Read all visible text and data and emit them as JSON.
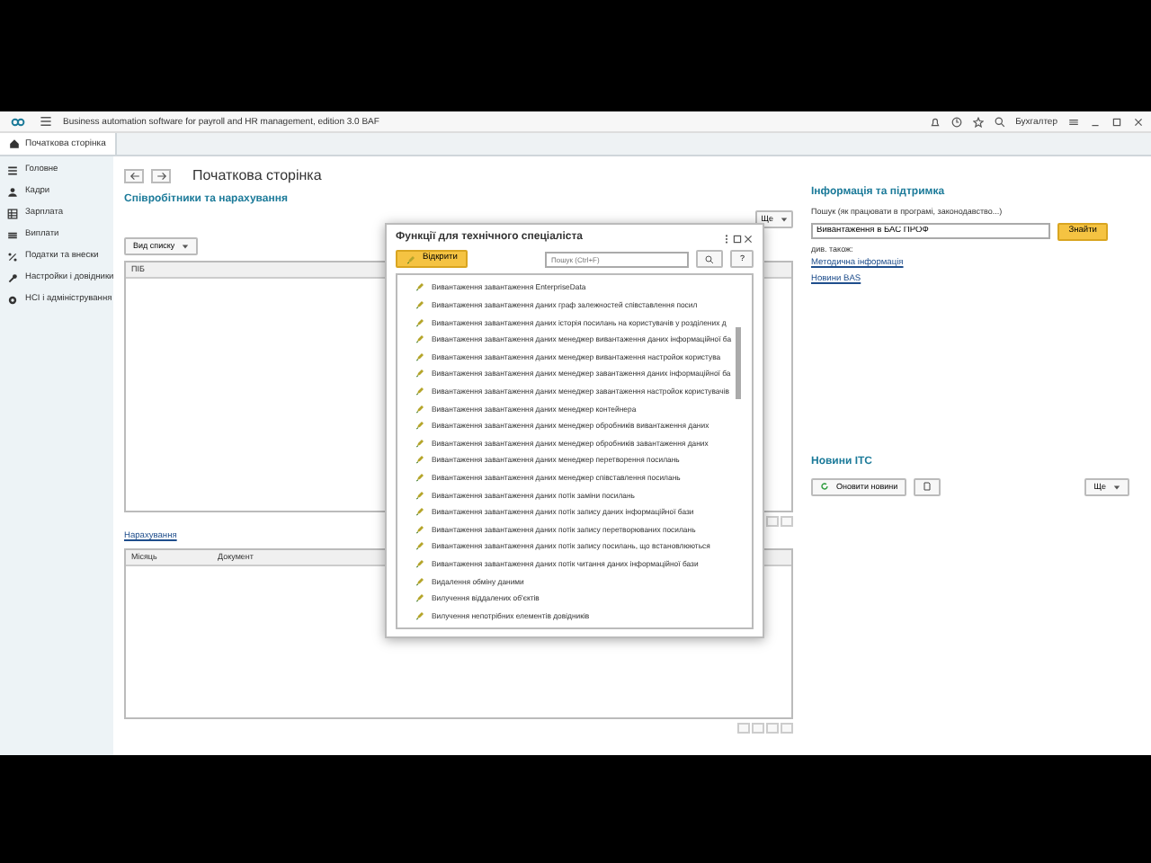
{
  "app": {
    "title": "Business automation software for payroll and HR management, edition 3.0 BAF",
    "user": "Бухгалтер"
  },
  "tabs": [
    {
      "label": "Початкова сторінка",
      "selected": true
    }
  ],
  "sidebar": {
    "items": [
      {
        "label": "Головне"
      },
      {
        "label": "Кадри"
      },
      {
        "label": "Зарплата"
      },
      {
        "label": "Виплати"
      },
      {
        "label": "Податки та внески"
      },
      {
        "label": "Настройки і довідники"
      },
      {
        "label": "НСІ і адміністрування"
      }
    ]
  },
  "page": {
    "title": "Початкова сторінка"
  },
  "employees": {
    "title": "Співробітники та нарахування",
    "view_button": "Вид списку",
    "more_button": "Ще",
    "columns": [
      "ПІБ"
    ]
  },
  "accruals": {
    "title": "Нарахування",
    "columns": [
      "Місяць",
      "Документ"
    ]
  },
  "info": {
    "title": "Інформація та підтримка",
    "search_label": "Пошук (як працювати в програмі, законодавство...)",
    "search_value": "Вивантаження в БАС ПРОФ",
    "search_button": "Знайти",
    "see_also": "див. також:",
    "links": [
      "Методична інформація",
      "Новини BAS"
    ]
  },
  "news": {
    "title": "Новини ІТС",
    "refresh_button": "Оновити новини",
    "more_button": "Ще"
  },
  "dialog": {
    "title": "Функції для технічного спеціаліста",
    "open_button": "Відкрити",
    "search_placeholder": "Пошук (Ctrl+F)",
    "help_button": "?",
    "items": [
      "Вивантаження завантаження EnterpriseData",
      "Вивантаження завантаження даних граф залежностей співставлення посил",
      "Вивантаження завантаження даних історія посилань на користувачів у розділених д",
      "Вивантаження завантаження даних менеджер вивантаження даних інформаційної ба",
      "Вивантаження завантаження даних менеджер вивантаження настройок користува",
      "Вивантаження завантаження даних менеджер завантаження даних інформаційної ба",
      "Вивантаження завантаження даних менеджер завантаження настройок користувачів",
      "Вивантаження завантаження даних менеджер контейнера",
      "Вивантаження завантаження даних менеджер обробників вивантаження даних",
      "Вивантаження завантаження даних менеджер обробників завантаження даних",
      "Вивантаження завантаження даних менеджер перетворення посилань",
      "Вивантаження завантаження даних менеджер співставлення посилань",
      "Вивантаження завантаження даних потік заміни посилань",
      "Вивантаження завантаження даних потік запису даних інформаційної бази",
      "Вивантаження завантаження даних потік запису перетворюваних посилань",
      "Вивантаження завантаження даних потік запису посилань, що встановлюються",
      "Вивантаження завантаження даних потік читання даних інформаційної бази",
      "Видалення обміну даними",
      "Вилучення віддалених об'єктів",
      "Вилучення непотрібних елементів довідників"
    ]
  }
}
